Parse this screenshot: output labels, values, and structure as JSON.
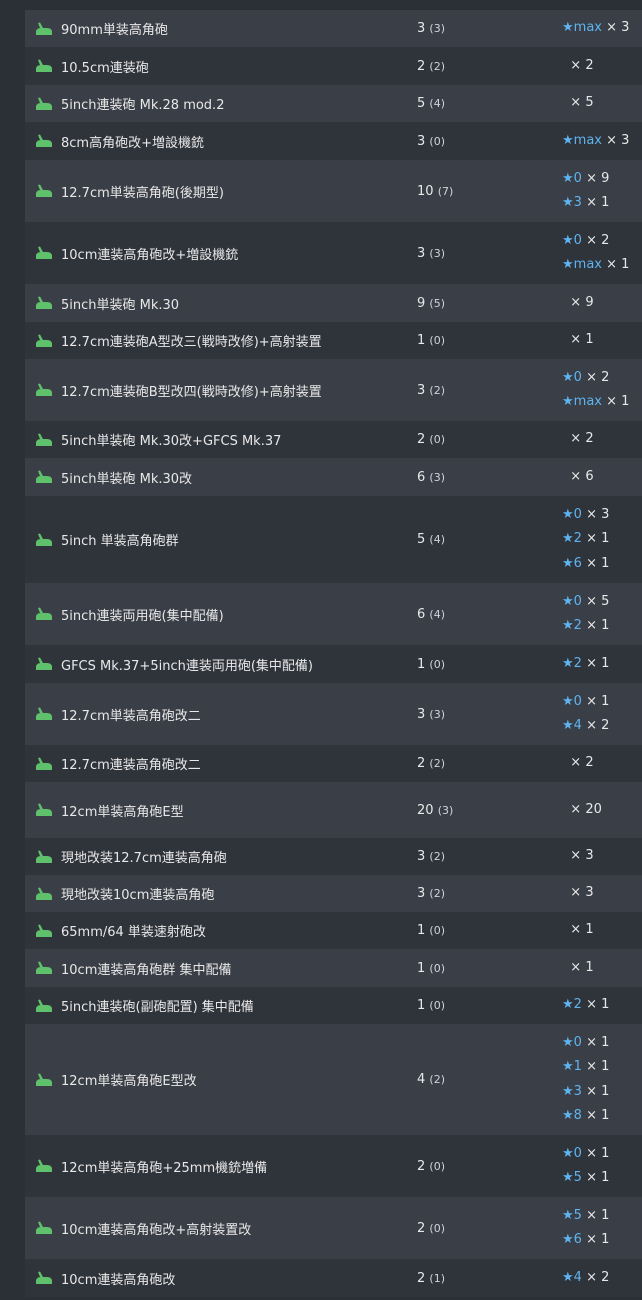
{
  "colors": {
    "page_bg": "#2b2f36",
    "row_odd": "#3a3e46",
    "row_even": "#2f333a",
    "icon_green": "#5fc16c",
    "star_blue": "#5fb4f0"
  },
  "icon": "green-gun-icon",
  "rows": [
    {
      "name": "90mm単装高角砲",
      "count": "3",
      "sub": "(3)",
      "improvements": [
        {
          "star": true,
          "level": "max",
          "count": "3"
        }
      ]
    },
    {
      "name": "10.5cm連装砲",
      "count": "2",
      "sub": "(2)",
      "improvements": [
        {
          "star": false,
          "level": "",
          "count": "2"
        }
      ]
    },
    {
      "name": "5inch連装砲 Mk.28 mod.2",
      "count": "5",
      "sub": "(4)",
      "improvements": [
        {
          "star": false,
          "level": "",
          "count": "5"
        }
      ]
    },
    {
      "name": "8cm高角砲改+増設機銃",
      "count": "3",
      "sub": "(0)",
      "improvements": [
        {
          "star": true,
          "level": "max",
          "count": "3"
        }
      ]
    },
    {
      "name": "12.7cm単装高角砲(後期型)",
      "count": "10",
      "sub": "(7)",
      "improvements": [
        {
          "star": true,
          "level": "0",
          "count": "9"
        },
        {
          "star": true,
          "level": "3",
          "count": "1"
        }
      ]
    },
    {
      "name": "10cm連装高角砲改+増設機銃",
      "count": "3",
      "sub": "(3)",
      "improvements": [
        {
          "star": true,
          "level": "0",
          "count": "2"
        },
        {
          "star": true,
          "level": "max",
          "count": "1"
        }
      ]
    },
    {
      "name": "5inch単装砲 Mk.30",
      "count": "9",
      "sub": "(5)",
      "improvements": [
        {
          "star": false,
          "level": "",
          "count": "9"
        }
      ]
    },
    {
      "name": "12.7cm連装砲A型改三(戦時改修)+高射装置",
      "count": "1",
      "sub": "(0)",
      "improvements": [
        {
          "star": false,
          "level": "",
          "count": "1"
        }
      ]
    },
    {
      "name": "12.7cm連装砲B型改四(戦時改修)+高射装置",
      "count": "3",
      "sub": "(2)",
      "improvements": [
        {
          "star": true,
          "level": "0",
          "count": "2"
        },
        {
          "star": true,
          "level": "max",
          "count": "1"
        }
      ]
    },
    {
      "name": "5inch単装砲 Mk.30改+GFCS Mk.37",
      "count": "2",
      "sub": "(0)",
      "improvements": [
        {
          "star": false,
          "level": "",
          "count": "2"
        }
      ]
    },
    {
      "name": "5inch単装砲 Mk.30改",
      "count": "6",
      "sub": "(3)",
      "improvements": [
        {
          "star": false,
          "level": "",
          "count": "6"
        }
      ]
    },
    {
      "name": "5inch 単装高角砲群",
      "count": "5",
      "sub": "(4)",
      "improvements": [
        {
          "star": true,
          "level": "0",
          "count": "3"
        },
        {
          "star": true,
          "level": "2",
          "count": "1"
        },
        {
          "star": true,
          "level": "6",
          "count": "1"
        }
      ]
    },
    {
      "name": "5inch連装両用砲(集中配備)",
      "count": "6",
      "sub": "(4)",
      "improvements": [
        {
          "star": true,
          "level": "0",
          "count": "5"
        },
        {
          "star": true,
          "level": "2",
          "count": "1"
        }
      ]
    },
    {
      "name": "GFCS Mk.37+5inch連装両用砲(集中配備)",
      "count": "1",
      "sub": "(0)",
      "improvements": [
        {
          "star": true,
          "level": "2",
          "count": "1"
        }
      ]
    },
    {
      "name": "12.7cm単装高角砲改二",
      "count": "3",
      "sub": "(3)",
      "improvements": [
        {
          "star": true,
          "level": "0",
          "count": "1"
        },
        {
          "star": true,
          "level": "4",
          "count": "2"
        }
      ]
    },
    {
      "name": "12.7cm連装高角砲改二",
      "count": "2",
      "sub": "(2)",
      "improvements": [
        {
          "star": false,
          "level": "",
          "count": "2"
        }
      ]
    },
    {
      "name": "12cm単装高角砲E型",
      "count": "20",
      "sub": "(3)",
      "improvements": [
        {
          "star": false,
          "level": "",
          "count": "20"
        }
      ]
    },
    {
      "name": "現地改装12.7cm連装高角砲",
      "count": "3",
      "sub": "(2)",
      "improvements": [
        {
          "star": false,
          "level": "",
          "count": "3"
        }
      ]
    },
    {
      "name": "現地改装10cm連装高角砲",
      "count": "3",
      "sub": "(2)",
      "improvements": [
        {
          "star": false,
          "level": "",
          "count": "3"
        }
      ]
    },
    {
      "name": "65mm/64 単装速射砲改",
      "count": "1",
      "sub": "(0)",
      "improvements": [
        {
          "star": false,
          "level": "",
          "count": "1"
        }
      ]
    },
    {
      "name": "10cm連装高角砲群 集中配備",
      "count": "1",
      "sub": "(0)",
      "improvements": [
        {
          "star": false,
          "level": "",
          "count": "1"
        }
      ]
    },
    {
      "name": "5inch連装砲(副砲配置) 集中配備",
      "count": "1",
      "sub": "(0)",
      "improvements": [
        {
          "star": true,
          "level": "2",
          "count": "1"
        }
      ]
    },
    {
      "name": "12cm単装高角砲E型改",
      "count": "4",
      "sub": "(2)",
      "improvements": [
        {
          "star": true,
          "level": "0",
          "count": "1"
        },
        {
          "star": true,
          "level": "1",
          "count": "1"
        },
        {
          "star": true,
          "level": "3",
          "count": "1"
        },
        {
          "star": true,
          "level": "8",
          "count": "1"
        }
      ]
    },
    {
      "name": "12cm単装高角砲+25mm機銃増備",
      "count": "2",
      "sub": "(0)",
      "improvements": [
        {
          "star": true,
          "level": "0",
          "count": "1"
        },
        {
          "star": true,
          "level": "5",
          "count": "1"
        }
      ]
    },
    {
      "name": "10cm連装高角砲改+高射装置改",
      "count": "2",
      "sub": "(0)",
      "improvements": [
        {
          "star": true,
          "level": "5",
          "count": "1"
        },
        {
          "star": true,
          "level": "6",
          "count": "1"
        }
      ]
    },
    {
      "name": "10cm連装高角砲改",
      "count": "2",
      "sub": "(1)",
      "improvements": [
        {
          "star": true,
          "level": "4",
          "count": "2"
        }
      ]
    }
  ]
}
